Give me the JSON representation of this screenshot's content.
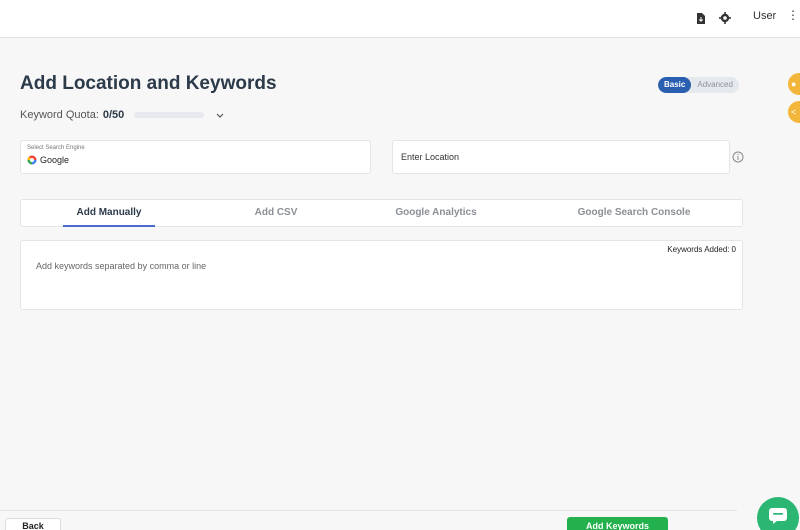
{
  "topbar": {
    "user_label": "User",
    "more_glyph": "⋮"
  },
  "page": {
    "title": "Add Location and Keywords",
    "mode_toggle": {
      "basic": "Basic",
      "advanced": "Advanced",
      "selected": "Basic"
    }
  },
  "quota": {
    "label": "Keyword Quota:",
    "value": "0/50",
    "fill_fraction": 0
  },
  "engine": {
    "label": "Select Search Engine",
    "value": "Google"
  },
  "location": {
    "placeholder": "Enter Location"
  },
  "tabs": [
    {
      "label": "Add Manually",
      "active": true
    },
    {
      "label": "Add CSV",
      "active": false
    },
    {
      "label": "Google Analytics",
      "active": false
    },
    {
      "label": "Google Search Console",
      "active": false
    }
  ],
  "keywords": {
    "added_label": "Keywords Added:",
    "added_count": "0",
    "placeholder": "Add keywords separated by comma or line"
  },
  "footer": {
    "back_label": "Back",
    "add_label": "Add Keywords"
  },
  "colors": {
    "accent_blue": "#2a5fb0",
    "tab_underline": "#4b6bcf",
    "primary_green": "#22b14c",
    "chat_green": "#2bb673",
    "side_yellow": "#f2b73a"
  },
  "icons": {
    "file": "file-download-icon",
    "settings": "gear-icon",
    "more": "more-vertical-icon",
    "info": "info-icon",
    "google": "google-icon",
    "chevron": "chevron-down-icon",
    "chat": "chat-icon"
  }
}
